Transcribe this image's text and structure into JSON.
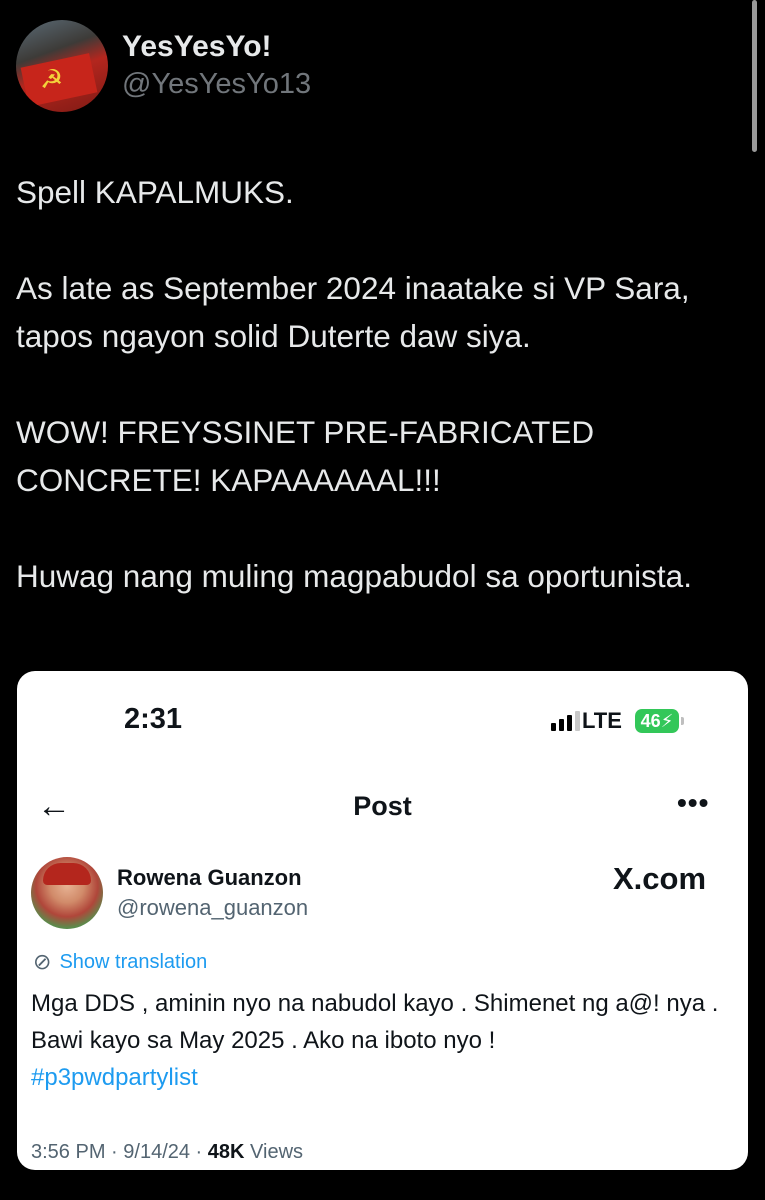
{
  "author": {
    "display_name": "YesYesYo!",
    "handle": "@YesYesYo13"
  },
  "tweet": {
    "paragraphs": [
      "Spell KAPALMUKS.",
      "As late as September 2024 inaatake si VP Sara, tapos ngayon solid Duterte daw siya.",
      "WOW! FREYSSINET PRE-FABRICATED CONCRETE! KAPAAAAAAL!!!",
      "Huwag nang muling magpabudol sa oportunista."
    ]
  },
  "embed": {
    "status": {
      "time": "2:31",
      "network": "LTE",
      "battery": "46"
    },
    "header": {
      "title": "Post",
      "back_icon": "arrow-left-icon",
      "more_icon": "more-horizontal-icon"
    },
    "post": {
      "name": "Rowena Guanzon",
      "handle": "@rowena_guanzon",
      "site": "X.com",
      "translate_label": "Show translation",
      "text": "Mga DDS , aminin nyo na nabudol kayo . Shimenet ng a@! nya . Bawi kayo sa May 2025 . Ako na iboto nyo !",
      "hashtag": "#p3pwdpartylist",
      "time": "3:56 PM",
      "date": "9/14/24",
      "views_count": "48K",
      "views_label": "Views"
    }
  },
  "colors": {
    "background": "#000000",
    "text": "#e7e9ea",
    "muted": "#71767b",
    "link": "#1d9bf0",
    "battery": "#33c759"
  }
}
